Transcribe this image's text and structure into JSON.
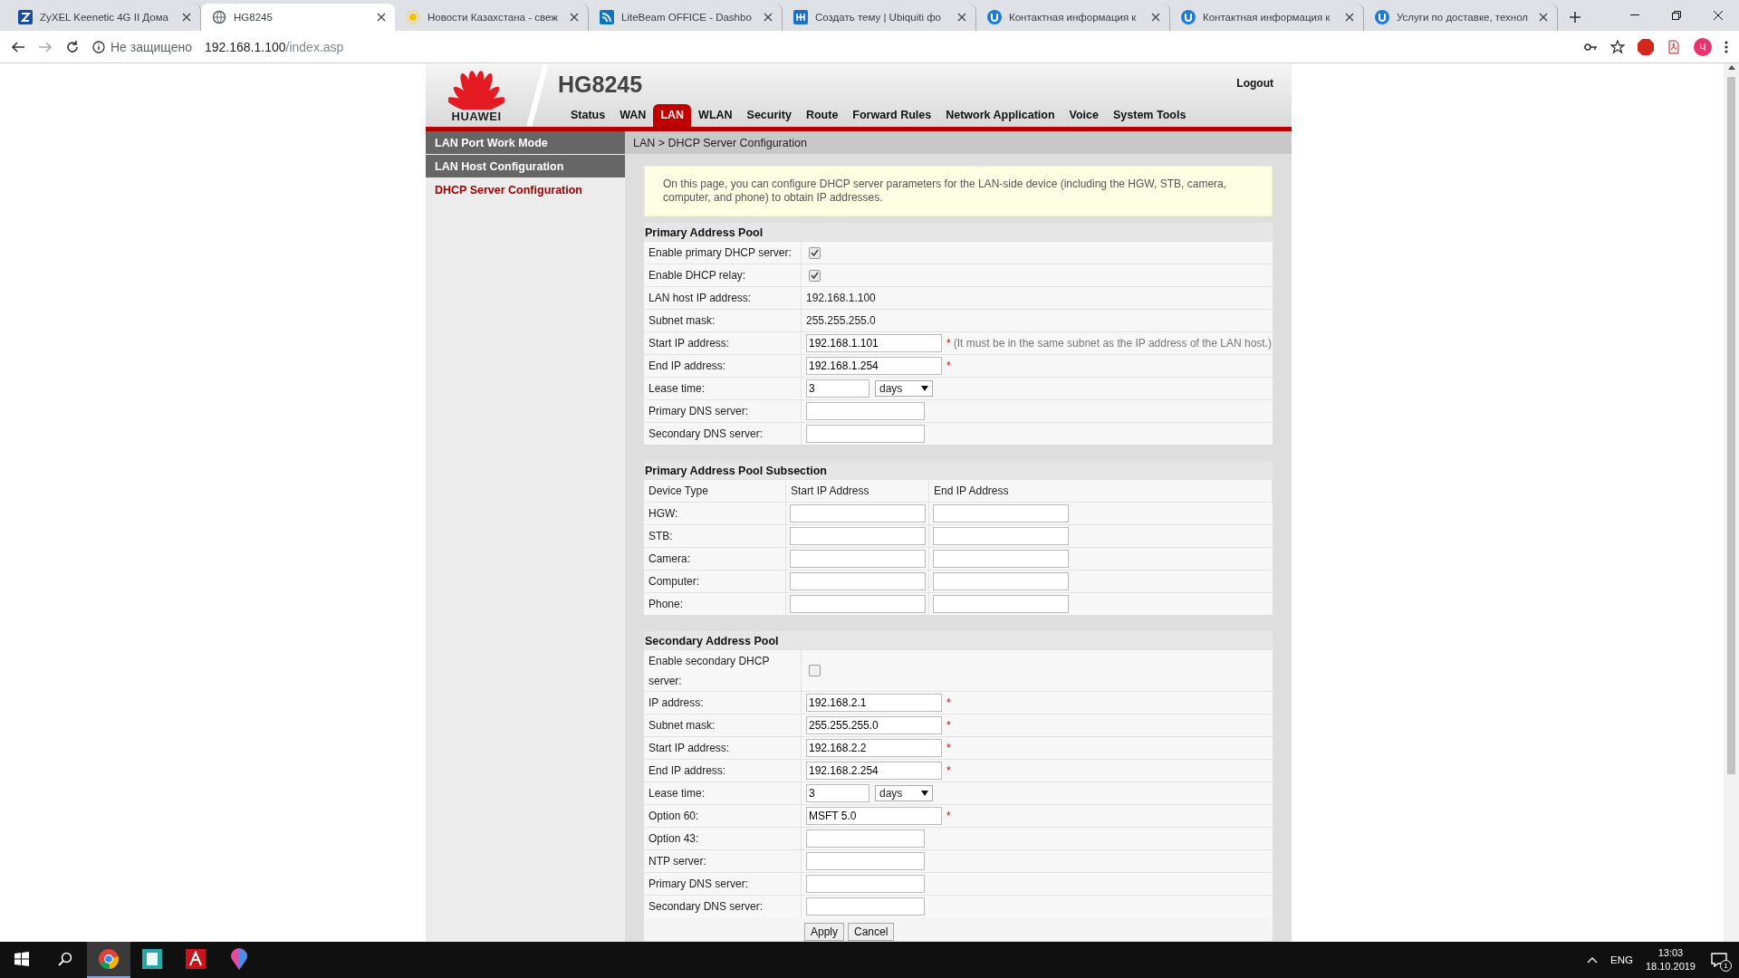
{
  "browser": {
    "tabs": [
      {
        "title": "ZyXEL Keenetic 4G II Дома",
        "selected": false,
        "kind": "zyxel"
      },
      {
        "title": "HG8245",
        "selected": true,
        "kind": "globe"
      },
      {
        "title": "Новости Казахстана - свеж",
        "selected": false,
        "kind": "sun"
      },
      {
        "title": "LiteBeam OFFICE - Dashbo",
        "selected": false,
        "kind": "feed"
      },
      {
        "title": "Создать тему | Ubiquiti фо",
        "selected": false,
        "kind": "grid"
      },
      {
        "title": "Контактная информация к",
        "selected": false,
        "kind": "ubnt"
      },
      {
        "title": "Контактная информация к",
        "selected": false,
        "kind": "ubnt"
      },
      {
        "title": "Услуги по доставке, технол",
        "selected": false,
        "kind": "ubnt"
      }
    ],
    "security": "Не защищено",
    "url_host": "192.168.1.100",
    "url_path": "/index.asp",
    "profile": "Ч"
  },
  "router": {
    "model": "HG8245",
    "brand": "HUAWEI",
    "logout": "Logout",
    "nav": [
      {
        "label": "Status",
        "selected": false
      },
      {
        "label": "WAN",
        "selected": false
      },
      {
        "label": "LAN",
        "selected": true
      },
      {
        "label": "WLAN",
        "selected": false
      },
      {
        "label": "Security",
        "selected": false
      },
      {
        "label": "Route",
        "selected": false
      },
      {
        "label": "Forward Rules",
        "selected": false
      },
      {
        "label": "Network Application",
        "selected": false
      },
      {
        "label": "Voice",
        "selected": false
      },
      {
        "label": "System Tools",
        "selected": false
      }
    ],
    "menu": [
      {
        "label": "LAN Port Work Mode",
        "selected": false
      },
      {
        "label": "LAN Host Configuration",
        "selected": false
      },
      {
        "label": "DHCP Server Configuration",
        "selected": true
      }
    ],
    "breadcrumb": "LAN > DHCP Server Configuration",
    "notice": "On this page, you can configure DHCP server parameters for the LAN-side device (including the HGW, STB, camera, computer, and phone) to obtain IP addresses.",
    "primary_pool": {
      "title": "Primary Address Pool",
      "rows": [
        {
          "kind": "checkbox",
          "label": "Enable primary DHCP server:",
          "checked": true
        },
        {
          "kind": "checkbox",
          "label": "Enable DHCP relay:",
          "checked": true
        },
        {
          "kind": "text",
          "label": "LAN host IP address:",
          "value": "192.168.1.100"
        },
        {
          "kind": "text",
          "label": "Subnet mask:",
          "value": "255.255.255.0"
        },
        {
          "kind": "input",
          "label": "Start IP address:",
          "value": "192.168.1.101",
          "asterisk": "*",
          "hint": "(It must be in the same subnet as the IP address of the LAN host.)"
        },
        {
          "kind": "input",
          "label": "End IP address:",
          "value": "192.168.1.254",
          "asterisk": "*"
        },
        {
          "kind": "lease",
          "label": "Lease time:",
          "value": "3",
          "unit": "days"
        },
        {
          "kind": "short",
          "label": "Primary DNS server:"
        },
        {
          "kind": "short",
          "label": "Secondary DNS server:"
        }
      ]
    },
    "subsection": {
      "title": "Primary Address Pool Subsection",
      "columns": [
        "Device Type",
        "Start IP Address",
        "End IP Address"
      ],
      "rows": [
        {
          "device": "HGW:"
        },
        {
          "device": "STB:"
        },
        {
          "device": "Camera:"
        },
        {
          "device": "Computer:"
        },
        {
          "device": "Phone:"
        }
      ]
    },
    "secondary_pool": {
      "title": "Secondary Address Pool",
      "rows": [
        {
          "kind": "checkbox",
          "label": "Enable secondary DHCP server:",
          "checked": false
        },
        {
          "kind": "input",
          "label": "IP address:",
          "value": "192.168.2.1",
          "asterisk": "*"
        },
        {
          "kind": "input",
          "label": "Subnet mask:",
          "value": "255.255.255.0",
          "asterisk": "*"
        },
        {
          "kind": "input",
          "label": "Start IP address:",
          "value": "192.168.2.2",
          "asterisk": "*"
        },
        {
          "kind": "input",
          "label": "End IP address:",
          "value": "192.168.2.254",
          "asterisk": "*"
        },
        {
          "kind": "lease",
          "label": "Lease time:",
          "value": "3",
          "unit": "days"
        },
        {
          "kind": "input",
          "label": "Option 60:",
          "value": "MSFT 5.0",
          "asterisk": "*"
        },
        {
          "kind": "short",
          "label": "Option 43:"
        },
        {
          "kind": "short",
          "label": "NTP server:"
        },
        {
          "kind": "short",
          "label": "Primary DNS server:"
        },
        {
          "kind": "short",
          "label": "Secondary DNS server:"
        }
      ]
    },
    "buttons": [
      "Apply",
      "Cancel"
    ]
  },
  "taskbar": {
    "apps": [
      {
        "kind": "chrome",
        "selected": true
      },
      {
        "kind": "teal",
        "selected": false
      },
      {
        "kind": "acrobat",
        "selected": false
      },
      {
        "kind": "pin",
        "selected": false
      }
    ],
    "language": "ENG",
    "time": "13:03",
    "date": "18.10.2019",
    "notifications": "1"
  }
}
